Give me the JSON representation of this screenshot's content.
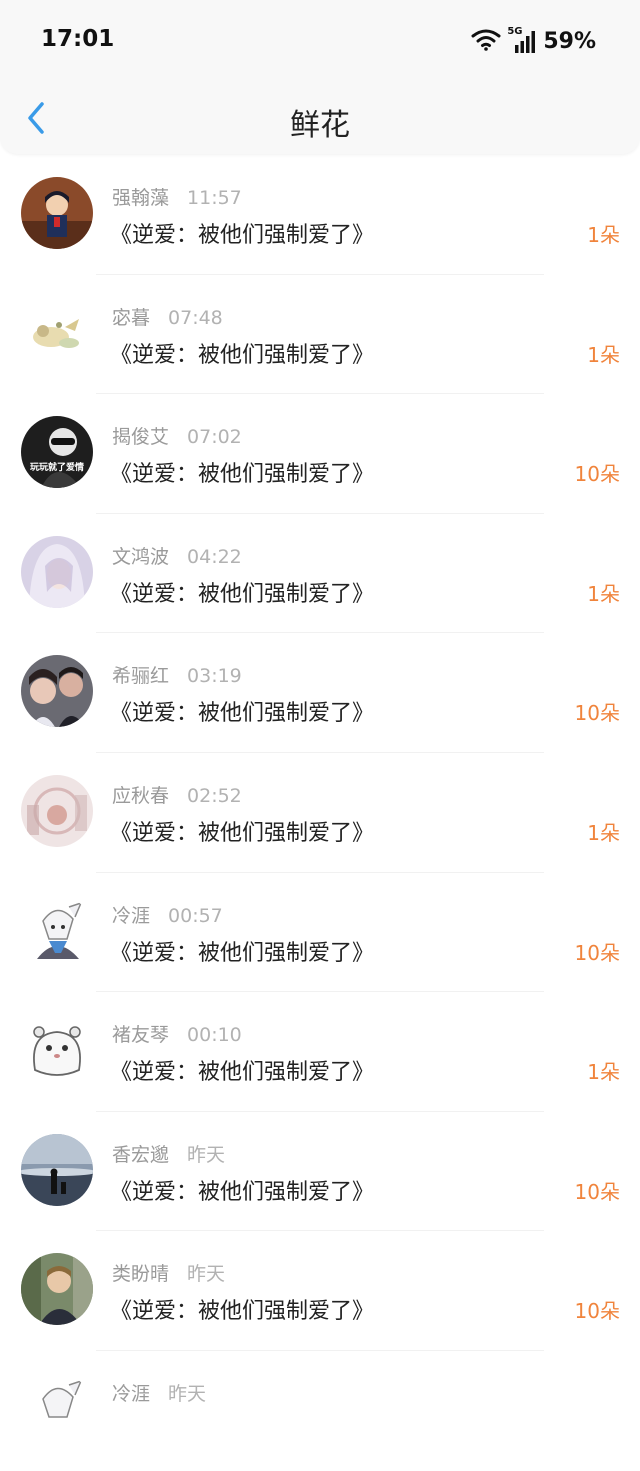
{
  "status_bar": {
    "time": "17:01",
    "network": "5G",
    "battery": "59%"
  },
  "header": {
    "title": "鲜花"
  },
  "rows": [
    {
      "name": "强翰藻",
      "time": "11:57",
      "book": "《逆爱：被他们强制爱了》",
      "amount": "1朵"
    },
    {
      "name": "宓暮",
      "time": "07:48",
      "book": "《逆爱：被他们强制爱了》",
      "amount": "1朵"
    },
    {
      "name": "揭俊艾",
      "time": "07:02",
      "book": "《逆爱：被他们强制爱了》",
      "amount": "10朵",
      "avatar_text": "玩玩就了爱情"
    },
    {
      "name": "文鸿波",
      "time": "04:22",
      "book": "《逆爱：被他们强制爱了》",
      "amount": "1朵"
    },
    {
      "name": "希骊红",
      "time": "03:19",
      "book": "《逆爱：被他们强制爱了》",
      "amount": "10朵"
    },
    {
      "name": "应秋春",
      "time": "02:52",
      "book": "《逆爱：被他们强制爱了》",
      "amount": "1朵"
    },
    {
      "name": "冷涯",
      "time": "00:57",
      "book": "《逆爱：被他们强制爱了》",
      "amount": "10朵"
    },
    {
      "name": "褚友琴",
      "time": "00:10",
      "book": "《逆爱：被他们强制爱了》",
      "amount": "1朵"
    },
    {
      "name": "香宏邈",
      "time": "昨天",
      "book": "《逆爱：被他们强制爱了》",
      "amount": "10朵"
    },
    {
      "name": "类盼晴",
      "time": "昨天",
      "book": "《逆爱：被他们强制爱了》",
      "amount": "10朵"
    },
    {
      "name": "冷涯",
      "time": "昨天",
      "book": "",
      "amount": ""
    }
  ],
  "colors": {
    "accent": "#3a9be8",
    "amount": "#f0843c",
    "name": "#9a9a9a"
  }
}
